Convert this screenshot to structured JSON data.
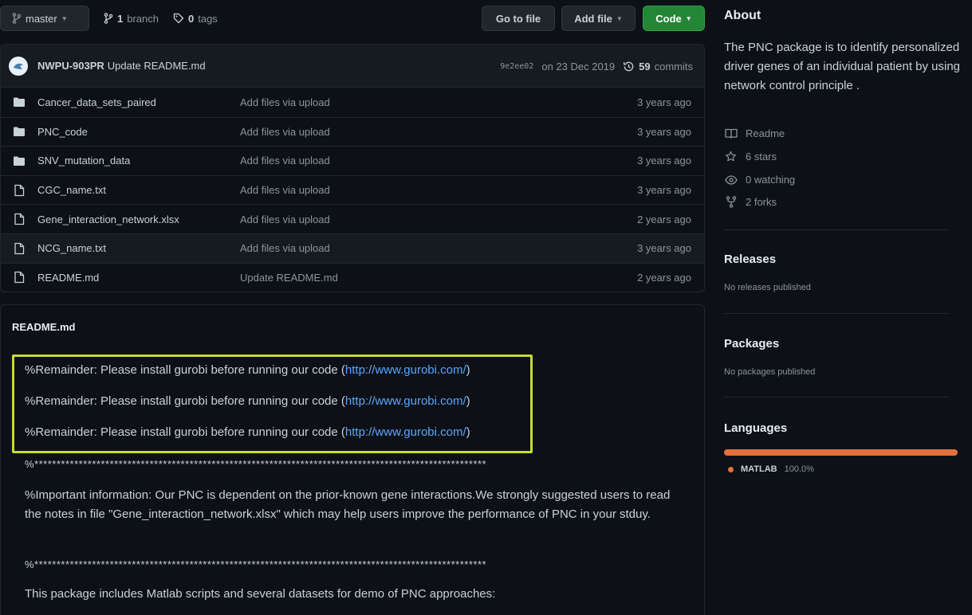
{
  "toolbar": {
    "branch": "master",
    "branches_count": "1",
    "branches_label": "branch",
    "tags_count": "0",
    "tags_label": "tags",
    "goto_file": "Go to file",
    "add_file": "Add file",
    "code": "Code"
  },
  "commit": {
    "author": "NWPU-903PR",
    "message": "Update README.md",
    "sha": "9e2ee02",
    "date": "on 23 Dec 2019",
    "commits_count": "59",
    "commits_label": "commits"
  },
  "files": [
    {
      "type": "folder",
      "name": "Cancer_data_sets_paired",
      "message": "Add files via upload",
      "age": "3 years ago"
    },
    {
      "type": "folder",
      "name": "PNC_code",
      "message": "Add files via upload",
      "age": "3 years ago"
    },
    {
      "type": "folder",
      "name": "SNV_mutation_data",
      "message": "Add files via upload",
      "age": "3 years ago"
    },
    {
      "type": "file",
      "name": "CGC_name.txt",
      "message": "Add files via upload",
      "age": "3 years ago"
    },
    {
      "type": "file",
      "name": "Gene_interaction_network.xlsx",
      "message": "Add files via upload",
      "age": "2 years ago"
    },
    {
      "type": "file",
      "name": "NCG_name.txt",
      "message": "Add files via upload",
      "age": "3 years ago"
    },
    {
      "type": "file",
      "name": "README.md",
      "message": "Update README.md",
      "age": "2 years ago"
    }
  ],
  "readme": {
    "title": "README.md",
    "reminder_text": "%Remainder: Please install gurobi before running our code (",
    "reminder_link": "http://www.gurobi.com/",
    "reminder_close": ")",
    "stars": "%******************************************************************************************************",
    "important": "%Important information: Our PNC is dependent on the prior-known gene interactions.We strongly suggested users to read the notes in file \"Gene_interaction_network.xlsx\" which may help users improve the performance of PNC in your stduy.",
    "package_line": "This package includes Matlab scripts and several datasets for demo of PNC approaches:"
  },
  "about": {
    "title": "About",
    "description": "The PNC package is to identify personalized driver genes of an individual patient by using network control principle .",
    "readme": "Readme",
    "stars": "6 stars",
    "watching": "0 watching",
    "forks": "2 forks"
  },
  "releases": {
    "title": "Releases",
    "note": "No releases published"
  },
  "packages": {
    "title": "Packages",
    "note": "No packages published"
  },
  "languages": {
    "title": "Languages",
    "name": "MATLAB",
    "percent": "100.0%",
    "fraction": 1.0
  },
  "colors": {
    "accent_green": "#238636",
    "link": "#58a6ff",
    "highlight": "#c7dd2c",
    "matlab": "#e4703a"
  }
}
